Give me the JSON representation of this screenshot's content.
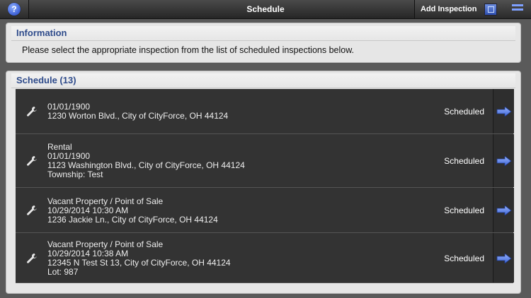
{
  "header": {
    "title": "Schedule",
    "help_icon": "?",
    "add_label": "Add Inspection"
  },
  "info": {
    "heading": "Information",
    "message": "Please select the appropriate inspection from the list of scheduled inspections below."
  },
  "schedule": {
    "heading": "Schedule (13)",
    "rows": [
      {
        "lines": [
          "01/01/1900",
          "1230  Worton Blvd., City of CityForce, OH 44124"
        ],
        "status": "Scheduled"
      },
      {
        "lines": [
          "Rental",
          "01/01/1900",
          "1123  Washington Blvd., City of CityForce, OH 44124",
          "Township: Test"
        ],
        "status": "Scheduled"
      },
      {
        "lines": [
          "Vacant Property / Point of Sale",
          "10/29/2014 10:30 AM",
          "1236  Jackie Ln., City of CityForce, OH 44124"
        ],
        "status": "Scheduled"
      },
      {
        "lines": [
          "Vacant Property / Point of Sale",
          "10/29/2014 10:38 AM",
          "12345 N Test St 13, City of CityForce, OH 44124",
          "Lot: 987"
        ],
        "status": "Scheduled"
      }
    ]
  },
  "colors": {
    "accent": "#2d4a8a",
    "arrow": "#4f7ae0",
    "row_bg": "#333333"
  }
}
